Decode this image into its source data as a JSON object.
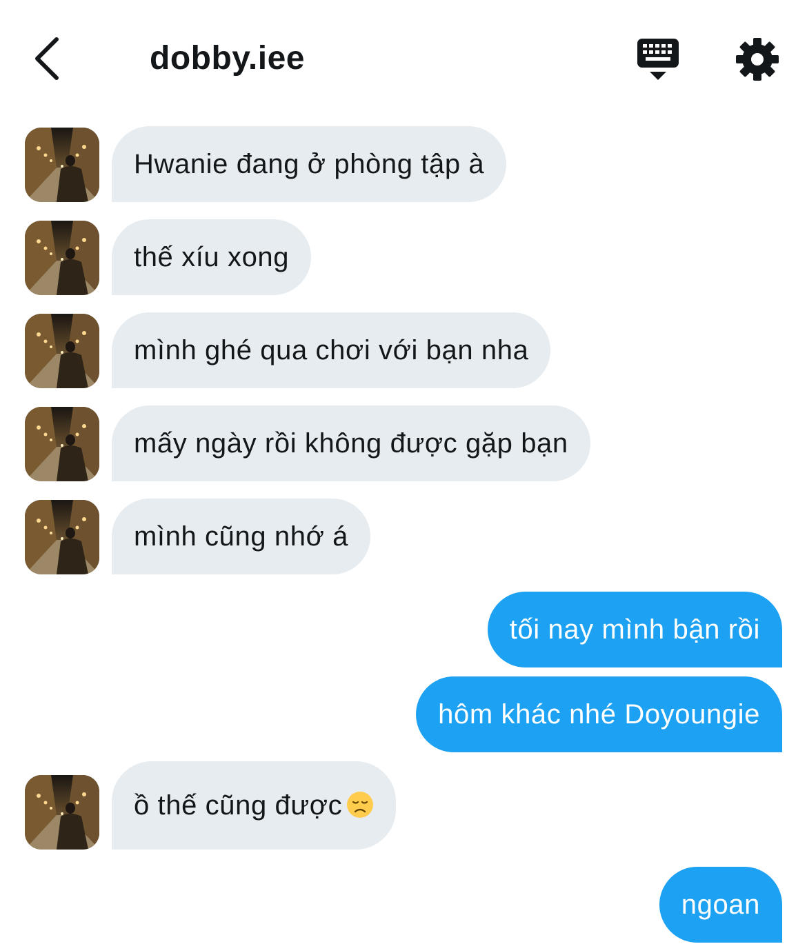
{
  "header": {
    "title": "dobby.iee",
    "back_icon": "chevron-left-icon",
    "keyboard_icon": "keyboard-icon",
    "settings_icon": "gear-icon"
  },
  "colors": {
    "incoming_bubble": "#e6ecf0",
    "outgoing_bubble": "#1da1f2",
    "text": "#14171a"
  },
  "messages": [
    {
      "side": "in",
      "text": "Hwanie đang ở phòng tập à"
    },
    {
      "side": "in",
      "text": "thế xíu xong"
    },
    {
      "side": "in",
      "text": "mình ghé qua chơi với bạn nha"
    },
    {
      "side": "in",
      "text": "mấy ngày rồi không được gặp bạn"
    },
    {
      "side": "in",
      "text": "mình cũng nhớ á"
    },
    {
      "side": "out",
      "text": "tối nay mình bận rồi"
    },
    {
      "side": "out",
      "text": "hôm khác nhé Doyoungie"
    },
    {
      "side": "in",
      "text": "ồ thế cũng được",
      "emoji": "disappointed-face-icon"
    },
    {
      "side": "out",
      "text": "ngoan"
    }
  ]
}
